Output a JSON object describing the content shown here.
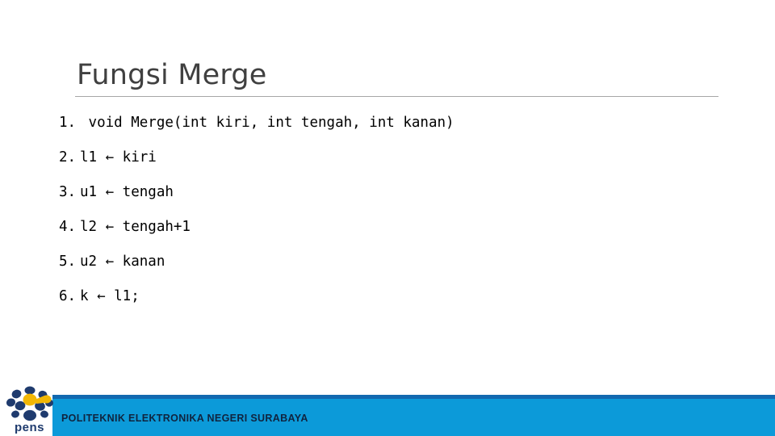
{
  "slide": {
    "title": "Fungsi Merge",
    "background_color": "#ffffff",
    "title_color": "#404040",
    "rule_color": "#a6a6a6"
  },
  "code": {
    "lines": [
      {
        "num": "1.",
        "text": " void Merge(int kiri, int tengah, int kanan)"
      },
      {
        "num": "2.",
        "text": "l1 ← kiri"
      },
      {
        "num": "3.",
        "text": "u1 ← tengah"
      },
      {
        "num": "4.",
        "text": "l2 ← tengah+1"
      },
      {
        "num": "5.",
        "text": "u2 ← kanan"
      },
      {
        "num": "6.",
        "text": "k ← l1;"
      }
    ]
  },
  "footer": {
    "institution": "POLITEKNIK ELEKTRONIKA NEGERI SURABAYA",
    "banner_color": "#0c9ad9",
    "banner_top_stripe_color": "#1269b0",
    "text_color": "#10243f",
    "logo": {
      "name": "pens-logo",
      "wordmark": "pens",
      "navy_color": "#1f3b6e",
      "gold_color": "#f2b705"
    }
  }
}
